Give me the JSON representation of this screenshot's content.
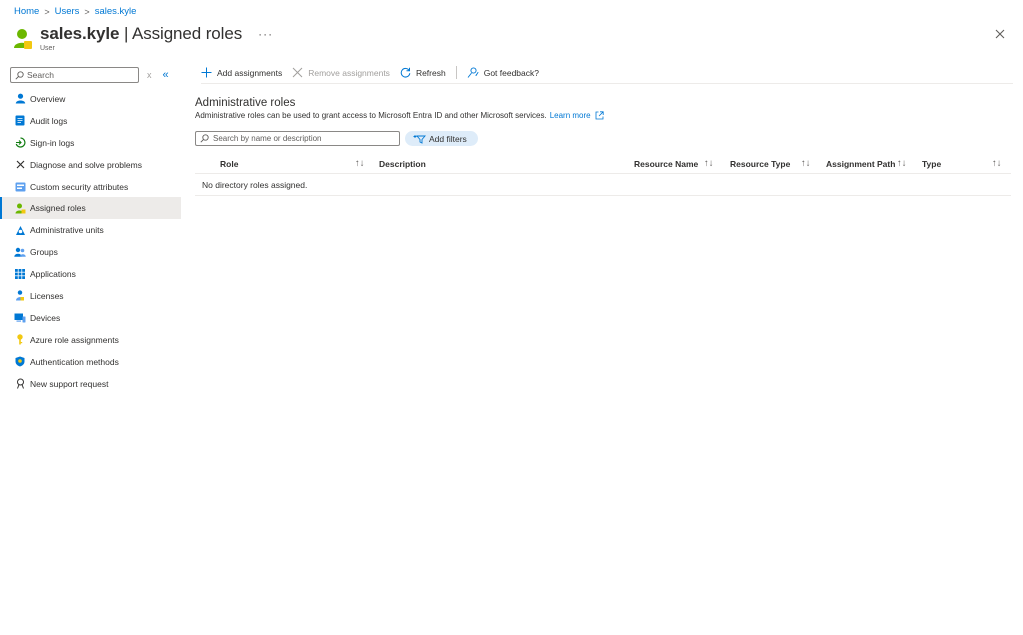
{
  "breadcrumb": {
    "items": [
      "Home",
      "Users",
      "sales.kyle"
    ],
    "sep": ">"
  },
  "header": {
    "name": "sales.kyle",
    "separator": " | ",
    "page": "Assigned roles",
    "more": "···",
    "subtitle": "User"
  },
  "sidebar": {
    "search_placeholder": "Search",
    "clear": "x",
    "collapse": "«",
    "items": [
      {
        "label": "Overview",
        "icon": "user-icon"
      },
      {
        "label": "Audit logs",
        "icon": "audit-log-icon"
      },
      {
        "label": "Sign-in logs",
        "icon": "sign-in-icon"
      },
      {
        "label": "Diagnose and solve problems",
        "icon": "wrench-icon"
      },
      {
        "label": "Custom security attributes",
        "icon": "attributes-icon"
      },
      {
        "label": "Assigned roles",
        "icon": "role-icon"
      },
      {
        "label": "Administrative units",
        "icon": "admin-units-icon"
      },
      {
        "label": "Groups",
        "icon": "groups-icon"
      },
      {
        "label": "Applications",
        "icon": "apps-grid-icon"
      },
      {
        "label": "Licenses",
        "icon": "license-icon"
      },
      {
        "label": "Devices",
        "icon": "devices-icon"
      },
      {
        "label": "Azure role assignments",
        "icon": "key-icon"
      },
      {
        "label": "Authentication methods",
        "icon": "shield-icon"
      },
      {
        "label": "New support request",
        "icon": "support-icon"
      }
    ]
  },
  "toolbar": {
    "add": "Add assignments",
    "remove": "Remove assignments",
    "refresh": "Refresh",
    "feedback": "Got feedback?"
  },
  "section": {
    "title": "Administrative roles",
    "description": "Administrative roles can be used to grant access to Microsoft Entra ID and other Microsoft services.",
    "learn_more": "Learn more"
  },
  "filters": {
    "search_placeholder": "Search by name or description",
    "add_filters": "Add filters"
  },
  "table": {
    "columns": {
      "role": "Role",
      "description": "Description",
      "resource_name": "Resource Name",
      "resource_type": "Resource Type",
      "assignment_path": "Assignment Path",
      "type": "Type"
    },
    "sort_glyph": "↑↓",
    "empty": "No directory roles assigned."
  },
  "colors": {
    "accent": "#0078d4",
    "active_bg": "#edebe9"
  }
}
